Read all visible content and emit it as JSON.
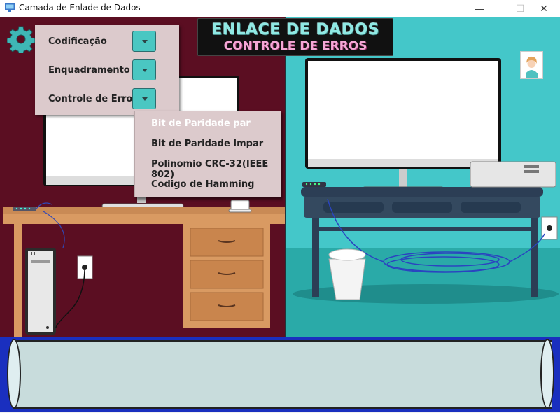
{
  "window": {
    "title": "Camada de Enlade de Dados",
    "minimize_glyph": "—",
    "maximize_glyph": "☐",
    "close_glyph": "✕"
  },
  "banner": {
    "line1": "ENLACE DE DADOS",
    "line2": "CONTROLE DE ERROS"
  },
  "settings_menu": {
    "items": [
      {
        "label": "Codificação"
      },
      {
        "label": "Enquadramento"
      },
      {
        "label": "Controle de Erros"
      }
    ]
  },
  "error_control_submenu": {
    "items": [
      {
        "label": "Bit de Paridade par",
        "state": "disabled"
      },
      {
        "label": "Bit de Paridade Impar",
        "state": "enabled"
      },
      {
        "label": "Polinomio CRC-32(IEEE 802)",
        "state": "enabled"
      },
      {
        "label": "Codigo de Hamming",
        "state": "enabled"
      }
    ]
  },
  "colors": {
    "left_room": "#5b0e22",
    "right_room": "#44c7c9",
    "menu_bg": "#dccacc",
    "dropdown_button": "#4ac7c2",
    "pipe_border": "#1a2fbf",
    "pipe_fill": "#c8dcdc"
  },
  "icons": {
    "settings": "gear-icon",
    "user": "avatar-icon",
    "dropdown": "chevron-down-icon"
  }
}
